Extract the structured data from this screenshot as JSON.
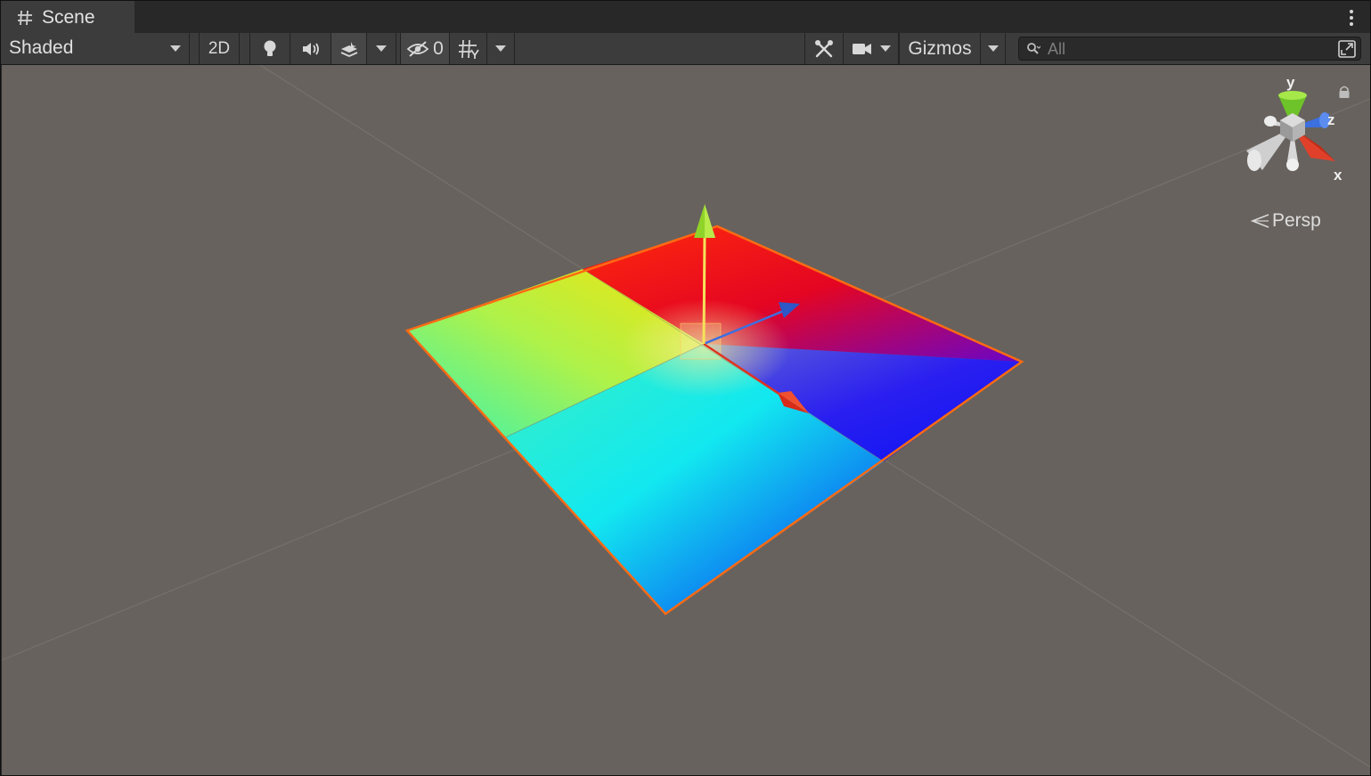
{
  "window": {
    "tab_title": "Scene"
  },
  "toolbar": {
    "draw_mode": "Shaded",
    "two_d_label": "2D",
    "hidden_count": "0",
    "gizmos_label": "Gizmos",
    "search_placeholder": "All"
  },
  "viewport": {
    "projection_label": "Persp",
    "axes": {
      "y": "y",
      "z": "z",
      "x": "x"
    }
  },
  "colors": {
    "accent_selection": "#ff6a13",
    "background": "#67625d",
    "toolbar": "#3c3c3c",
    "x_axis": "#e0321e",
    "y_axis": "#8fd22a",
    "z_axis": "#3c6fe0"
  },
  "icons": {
    "tab": "scene-grid-icon",
    "lighting": "lightbulb-icon",
    "audio": "speaker-icon",
    "effects": "layers-icon",
    "visibility": "eye-slash-icon",
    "grid": "grid-snap-icon",
    "tools": "tools-icon",
    "camera": "camera-icon",
    "search": "search-icon",
    "maximize": "maximize-icon",
    "lock": "lock-icon"
  }
}
